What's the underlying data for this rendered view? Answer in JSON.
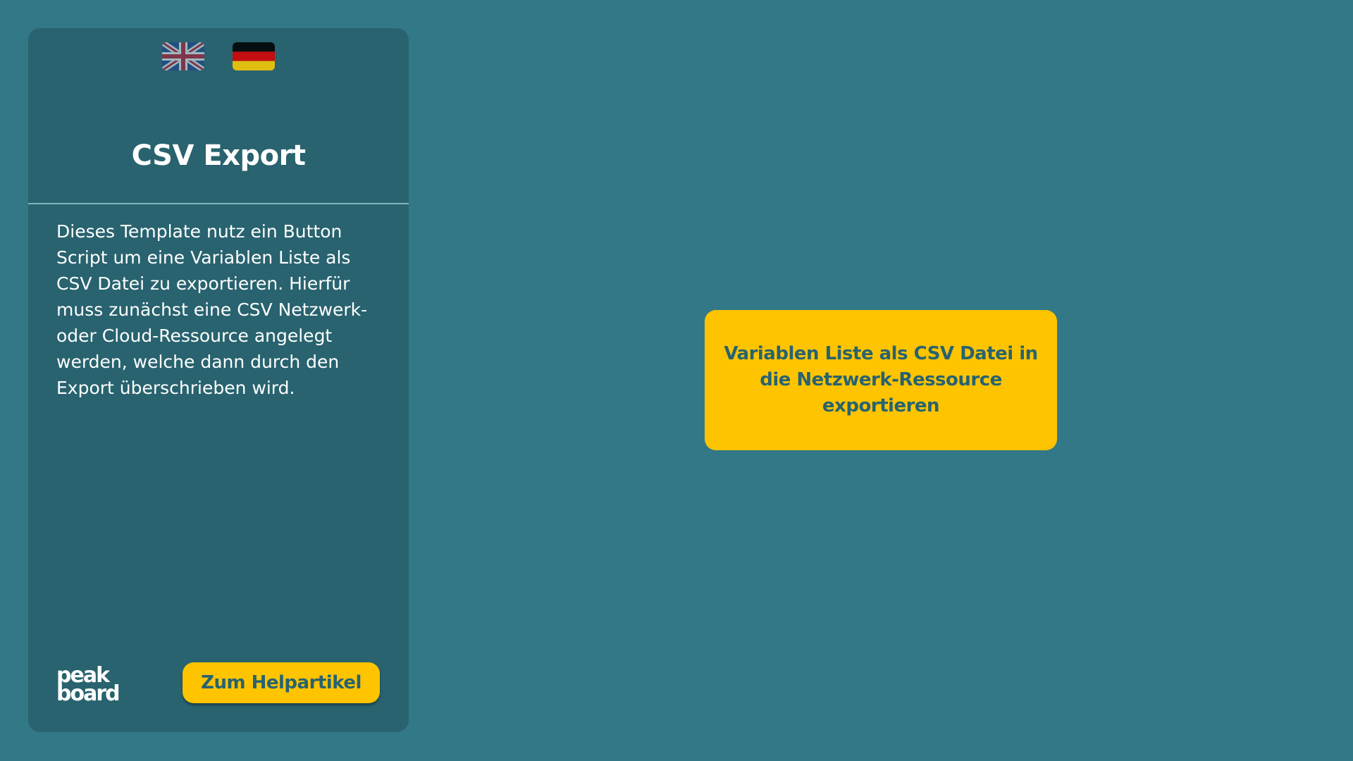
{
  "panel": {
    "flags": [
      {
        "icon": "uk-flag-icon",
        "label": "English"
      },
      {
        "icon": "germany-flag-icon",
        "label": "Deutsch"
      }
    ],
    "title": "CSV Export",
    "description": "Dieses Template nutz ein Button Script um eine Variablen Liste als CSV Datei zu exportieren. Hierfür muss zunächst eine CSV Netzwerk- oder Cloud-Ressource angelegt werden, welche dann durch den Export überschrieben wird.",
    "logo_text_line1": "peak",
    "logo_text_line2": "board",
    "help_button_label": "Zum Helpartikel"
  },
  "main": {
    "export_button_label": "Variablen Liste als CSV Datei in die Netzwerk-Ressource exportieren"
  },
  "colors": {
    "background": "#337886",
    "panel": "#28636f",
    "accent": "#ffc400",
    "accent_text": "#28636f",
    "divider": "#7fb4bf"
  }
}
